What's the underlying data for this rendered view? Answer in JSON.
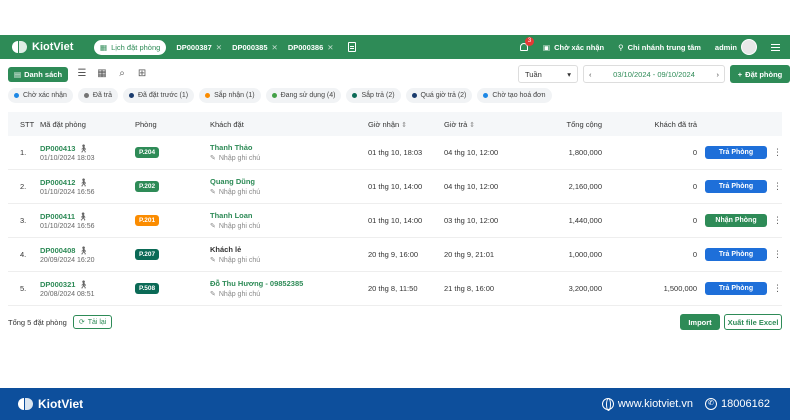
{
  "brand": "KiotViet",
  "header": {
    "tabs": [
      {
        "label": "Lịch đặt phòng",
        "active": true
      },
      {
        "label": "DP000387"
      },
      {
        "label": "DP000385"
      },
      {
        "label": "DP000386"
      }
    ],
    "notification_count": "3",
    "pending_label": "Chờ xác nhận",
    "branch_label": "Chi nhánh trung tâm",
    "user_label": "admin"
  },
  "toolbar": {
    "list_label": "Danh sách",
    "period": "Tuần",
    "date_range": "03/10/2024 - 09/10/2024",
    "add_label": "Đặt phòng"
  },
  "filters": [
    {
      "label": "Chờ xác nhận",
      "color": "#1e88e5"
    },
    {
      "label": "Đã trả",
      "color": "#757575"
    },
    {
      "label": "Đã đặt trước (1)",
      "color": "#1a3b6d"
    },
    {
      "label": "Sắp nhận (1)",
      "color": "#fb8c00"
    },
    {
      "label": "Đang sử dụng (4)",
      "color": "#43a047"
    },
    {
      "label": "Sắp trả (2)",
      "color": "#0b6a56"
    },
    {
      "label": "Quá giờ trả (2)",
      "color": "#1a3b6d"
    },
    {
      "label": "Chờ tạo hoá đơn",
      "color": "#1e88e5"
    }
  ],
  "table": {
    "headers": {
      "stt": "STT",
      "code": "Mã đặt phòng",
      "room": "Phòng",
      "guest": "Khách đặt",
      "checkin": "Giờ nhận",
      "checkout": "Giờ trả",
      "total": "Tổng cộng",
      "paid": "Khách đã trả"
    },
    "note_placeholder": "Nhập ghi chú",
    "rows": [
      {
        "stt": "1.",
        "code": "DP000413",
        "date": "01/10/2024 18:03",
        "room": "P.204",
        "room_color": "#2e8b57",
        "guest": "Thanh Thảo",
        "checkin": "01 thg 10, 18:03",
        "checkout": "04 thg 10, 12:00",
        "total": "1,800,000",
        "paid": "0",
        "action": "Trả Phòng",
        "action_color": "#1e6fd9"
      },
      {
        "stt": "2.",
        "code": "DP000412",
        "date": "01/10/2024 16:56",
        "room": "P.202",
        "room_color": "#2e8b57",
        "guest": "Quang Dũng",
        "checkin": "01 thg 10, 14:00",
        "checkout": "04 thg 10, 12:00",
        "total": "2,160,000",
        "paid": "0",
        "action": "Trả Phòng",
        "action_color": "#1e6fd9"
      },
      {
        "stt": "3.",
        "code": "DP000411",
        "date": "01/10/2024 16:56",
        "room": "P.201",
        "room_color": "#fb8c00",
        "guest": "Thanh Loan",
        "checkin": "01 thg 10, 14:00",
        "checkout": "03 thg 10, 12:00",
        "total": "1,440,000",
        "paid": "0",
        "action": "Nhận Phòng",
        "action_color": "#2e8b57"
      },
      {
        "stt": "4.",
        "code": "DP000408",
        "date": "20/09/2024 16:20",
        "room": "P.207",
        "room_color": "#0b6a56",
        "guest": "Khách lẻ",
        "guest_plain": true,
        "checkin": "20 thg 9, 16:00",
        "checkout": "20 thg 9, 21:01",
        "total": "1,000,000",
        "paid": "0",
        "action": "Trả Phòng",
        "action_color": "#1e6fd9"
      },
      {
        "stt": "5.",
        "code": "DP000321",
        "date": "20/08/2024 08:51",
        "room": "P.508",
        "room_color": "#0b6a56",
        "guest": "Đỗ Thu Hương - 09852385",
        "checkin": "20 thg 8, 11:50",
        "checkout": "21 thg 8, 16:00",
        "total": "3,200,000",
        "paid": "1,500,000",
        "action": "Trả Phòng",
        "action_color": "#1e6fd9"
      }
    ]
  },
  "footer": {
    "total_label": "Tổng 5 đặt phòng",
    "reload_label": "Tải lại",
    "import_label": "Import",
    "export_label": "Xuất file Excel"
  },
  "bottom_bar": {
    "brand": "KiotViet",
    "website": "www.kiotviet.vn",
    "hotline": "18006162"
  }
}
